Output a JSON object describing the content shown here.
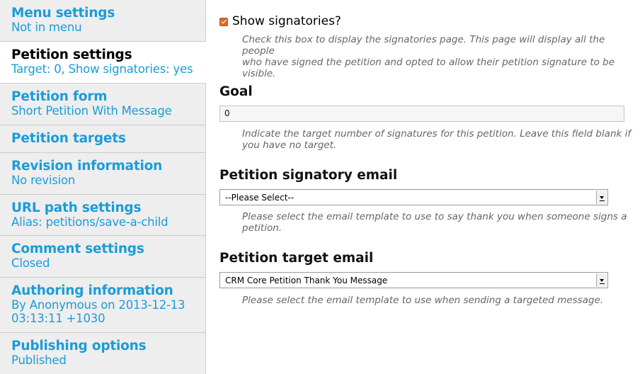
{
  "sidebar": {
    "tabs": [
      {
        "title": "Menu settings",
        "summary": "Not in menu"
      },
      {
        "title": "Petition settings",
        "summary": "Target: 0, Show signatories: yes"
      },
      {
        "title": "Petition form",
        "summary": "Short Petition With Message"
      },
      {
        "title": "Petition targets",
        "summary": ""
      },
      {
        "title": "Revision information",
        "summary": "No revision"
      },
      {
        "title": "URL path settings",
        "summary": "Alias: petitions/save-a-child"
      },
      {
        "title": "Comment settings",
        "summary": "Closed"
      },
      {
        "title": "Authoring information",
        "summary_line1": "By Anonymous on 2013-12-13",
        "summary_line2": "03:13:11 +1030"
      },
      {
        "title": "Publishing options",
        "summary": "Published"
      }
    ]
  },
  "main": {
    "show_signatories": {
      "label": "Show signatories?",
      "checked": true,
      "description_line1": "Check this box to display the signatories page. This page will display all the people",
      "description_line2": "who have signed the petition and opted to allow their petition signature to be",
      "description_line3": "visible."
    },
    "goal": {
      "heading": "Goal",
      "value": "0",
      "description_line1": "Indicate the target number of signatures for this petition. Leave this field blank if",
      "description_line2": "you have no target."
    },
    "signatory_email": {
      "heading": "Petition signatory email",
      "selected": "--Please Select--",
      "description_line1": "Please select the email template to use to say thank you when someone signs a",
      "description_line2": "petition."
    },
    "target_email": {
      "heading": "Petition target email",
      "selected": "CRM Core Petition Thank You Message",
      "description_line1": "Please select the email template to use when sending a targeted message."
    }
  },
  "colors": {
    "link": "#1c9cd7",
    "sidebar_bg": "#eeeeee",
    "checkbox_accent": "#e06a2a"
  }
}
